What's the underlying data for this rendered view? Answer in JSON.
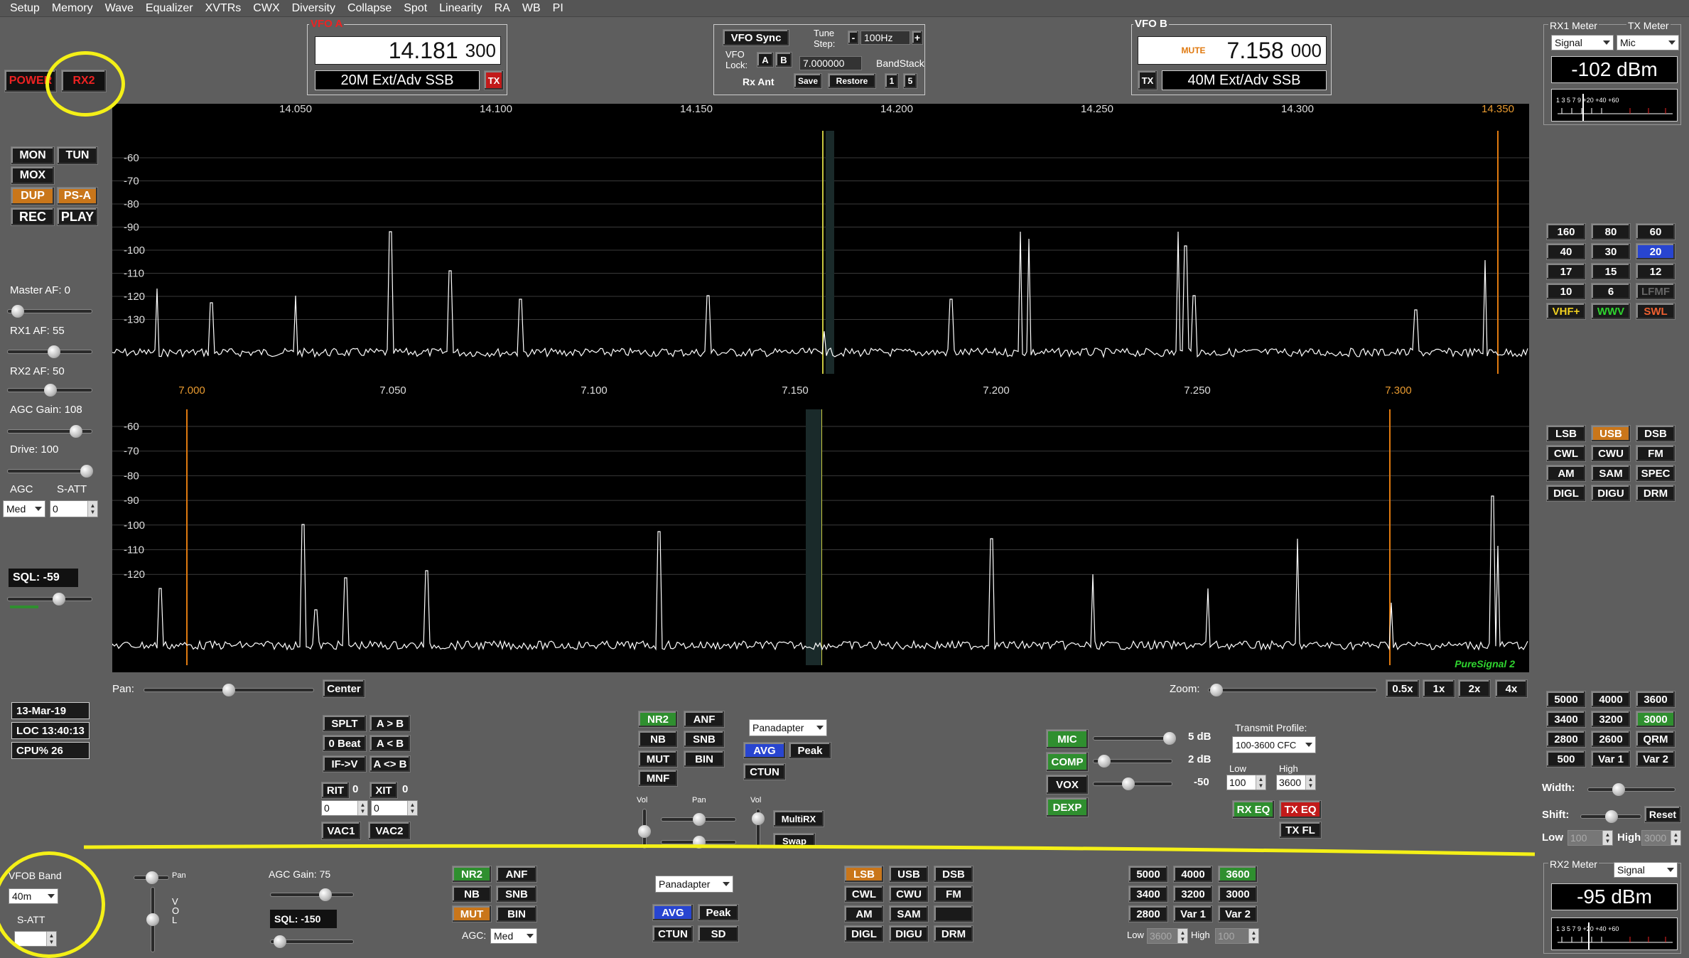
{
  "menu": [
    "Setup",
    "Memory",
    "Wave",
    "Equalizer",
    "XVTRs",
    "CWX",
    "Diversity",
    "Collapse",
    "Spot",
    "Linearity",
    "RA",
    "WB",
    "PI"
  ],
  "left": {
    "power": "POWER",
    "rx2": "RX2",
    "mon": "MON",
    "tun": "TUN",
    "mox": "MOX",
    "dup": "DUP",
    "psa": "PS-A",
    "rec": "REC",
    "play": "PLAY",
    "master_af": "Master AF:  0",
    "rx1_af": "RX1 AF:  55",
    "rx2_af": "RX2 AF:  50",
    "agc_gain": "AGC Gain:  108",
    "drive": "Drive:  100",
    "agc": "AGC",
    "satt": "S-ATT",
    "agc_value": "Med",
    "satt_value": "0",
    "sql": "SQL:  -59",
    "date": "13-Mar-19",
    "loc": "LOC 13:40:13",
    "cpu": "CPU%  26",
    "master_af_level": 0.05,
    "rx1_af_level": 0.55,
    "rx2_af_level": 0.5,
    "agc_gain_level": 0.85,
    "drive_level": 1.0,
    "sql_level": 0.62
  },
  "vfoa": {
    "title": "VFO A",
    "freq_main": "14.181",
    "freq_sub": "300",
    "mode": "20M Ext/Adv SSB",
    "tx": "TX"
  },
  "vfob": {
    "title": "VFO B",
    "mute": "MUTE",
    "freq_main": "7.158",
    "freq_sub": "000",
    "mode": "40M Ext/Adv SSB",
    "tx": "TX"
  },
  "center_ctrl": {
    "vfo_sync": "VFO Sync",
    "tune_step": "Tune\nStep:",
    "minus": "-",
    "step": "100Hz",
    "plus": "+",
    "vfo_lock": "VFO\nLock:",
    "a": "A",
    "b": "B",
    "lock_freq": "7.000000",
    "bandstack": "BandStack",
    "rx_ant": "Rx Ant",
    "save": "Save",
    "restore": "Restore",
    "one": "1",
    "five": "5"
  },
  "rx1_meter": {
    "title": "RX1 Meter",
    "tx_title": "TX Meter",
    "sel": "Signal",
    "tx_sel": "Mic",
    "reading": "-102 dBm",
    "scale": "1 3 5 7 9 +20 +40 +60"
  },
  "rx2_meter": {
    "title": "RX2 Meter",
    "sel": "Signal",
    "reading": "-95 dBm",
    "scale": "1 3 5 7 9 +20 +40 +60"
  },
  "top_panel": {
    "freq_labels": [
      "14.050",
      "14.100",
      "14.150",
      "14.200",
      "14.250",
      "14.300",
      "14.350"
    ],
    "db_labels": [
      "-60",
      "-70",
      "-80",
      "-90",
      "-100",
      "-110",
      "-120",
      "-130"
    ]
  },
  "bottom_panel": {
    "freq_labels": [
      "7.000",
      "7.050",
      "7.100",
      "7.150",
      "7.200",
      "7.250",
      "7.300"
    ],
    "db_labels": [
      "-60",
      "-70",
      "-80",
      "-90",
      "-100",
      "-110",
      "-120"
    ],
    "ps_label": "PureSignal 2"
  },
  "band_buttons": [
    "160",
    "80",
    "60",
    "40",
    "30",
    "20",
    "17",
    "15",
    "12",
    "10",
    "6",
    "LFMF",
    "VHF+",
    "WWV",
    "SWL"
  ],
  "mode_buttons": [
    "LSB",
    "USB",
    "DSB",
    "CWL",
    "CWU",
    "FM",
    "AM",
    "SAM",
    "SPEC",
    "DIGL",
    "DIGU",
    "DRM"
  ],
  "filter_buttons": [
    "5000",
    "4000",
    "3600",
    "3400",
    "3200",
    "3000",
    "2800",
    "2600",
    "QRM",
    "500",
    "Var 1",
    "Var 2"
  ],
  "filter_side": {
    "width": "Width:",
    "shift": "Shift:",
    "reset": "Reset",
    "low": "Low",
    "low_val": "100",
    "high": "High",
    "high_val": "3000"
  },
  "pan": {
    "label": "Pan:",
    "center": "Center",
    "zoom": "Zoom:",
    "z05": "0.5x",
    "z1": "1x",
    "z2": "2x",
    "z4": "4x"
  },
  "split": {
    "splt": "SPLT",
    "atob": "A > B",
    "zbeat": "0 Beat",
    "btoa": "A < B",
    "ifv": "IF->V",
    "swap": "A <> B",
    "rit": "RIT",
    "rit_val": "0",
    "xit": "XIT",
    "xit_val": "0",
    "rit_box": "0",
    "xit_box": "0",
    "vac1": "VAC1",
    "vac2": "VAC2"
  },
  "dsp1": {
    "nr2": "NR2",
    "anf": "ANF",
    "nb": "NB",
    "snb": "SNB",
    "mut": "MUT",
    "bin": "BIN",
    "mnf": "MNF",
    "display": "Panadapter",
    "avg": "AVG",
    "peak": "Peak",
    "ctun": "CTUN",
    "vol": "Vol",
    "pan": "Pan",
    "vol2": "Vol",
    "multirx": "MultiRX",
    "swap": "Swap"
  },
  "tx": {
    "mic": "MIC",
    "mic_val": "5 dB",
    "comp": "COMP",
    "comp_val": "2 dB",
    "vox": "VOX",
    "vox_val": "-50",
    "dexp": "DEXP",
    "profile_label": "Transmit Profile:",
    "profile": "100-3600 CFC",
    "low": "Low",
    "high": "High",
    "low_val": "100",
    "high_val": "3600",
    "rxeq": "RX EQ",
    "txeq": "TX EQ",
    "txfl": "TX FL"
  },
  "rx2": {
    "band_label": "VFOB Band",
    "band": "40m",
    "satt": "S-ATT",
    "pan": "Pan",
    "vol": "V\nO\nL",
    "agc_gain": "AGC Gain:  75",
    "sql": "SQL:  -150",
    "nr2": "NR2",
    "anf": "ANF",
    "nb": "NB",
    "snb": "SNB",
    "mut": "MUT",
    "bin": "BIN",
    "agc": "AGC:",
    "agc_val": "Med",
    "display": "Panadapter",
    "avg": "AVG",
    "peak": "Peak",
    "ctun": "CTUN",
    "sd": "SD",
    "modes": [
      "LSB",
      "USB",
      "DSB",
      "CWL",
      "CWU",
      "FM",
      "AM",
      "SAM",
      "",
      "DIGL",
      "DIGU",
      "DRM"
    ],
    "filters": [
      "5000",
      "4000",
      "3600",
      "3400",
      "3200",
      "3000",
      "2800",
      "Var 1",
      "Var 2"
    ],
    "low": "Low",
    "low_val": "3600",
    "high": "High",
    "high_val": "100"
  },
  "colors": {
    "accent_orange": "#c9761a",
    "active_green": "#2f8f2f",
    "active_blue": "#2845d0",
    "red": "#c21a1a",
    "annotation": "#f4f017"
  }
}
